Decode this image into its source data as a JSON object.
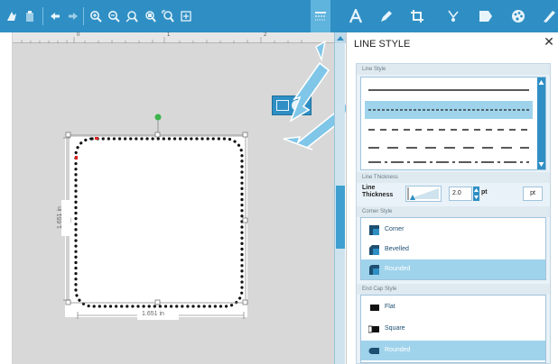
{
  "panel": {
    "title": "LINE STYLE",
    "close_glyph": "✕",
    "sections": {
      "line_style": "Line Style",
      "line_thickness": "Line Thickness",
      "corner_style": "Corner Style",
      "end_cap_style": "End Cap Style"
    },
    "line_styles": [
      "solid",
      "dash-fine",
      "dash-medium",
      "dash-long",
      "dash-dot"
    ],
    "selected_line_style": 1,
    "thickness": {
      "label_line1": "Line",
      "label_line2": "Thickness",
      "value": "2.0",
      "unit": "pt",
      "unit_button": "pt"
    },
    "corner_options": [
      {
        "label": "Corner",
        "icon": "corner-square-icon",
        "selected": false
      },
      {
        "label": "Bevelled",
        "icon": "corner-bevel-icon",
        "selected": false
      },
      {
        "label": "Rounded",
        "icon": "corner-round-icon",
        "selected": true
      }
    ],
    "end_cap_options": [
      {
        "label": "Flat",
        "icon": "cap-flat-icon",
        "selected": false
      },
      {
        "label": "Square",
        "icon": "cap-square-icon",
        "selected": false
      },
      {
        "label": "Rounded",
        "icon": "cap-round-icon",
        "selected": true
      }
    ]
  },
  "canvas": {
    "width_label": "1.651 in",
    "height_label": "1.651 in",
    "ruler_marks": [
      "0",
      "1",
      "2"
    ]
  },
  "colors": {
    "toolbar": "#2f8fc4",
    "accent": "#3fa0d0",
    "selection": "#9fd3ec",
    "handle_green": "#3db34a"
  },
  "toolbar_icons": [
    "pick-tool-icon",
    "paste-icon",
    "undo-icon",
    "redo-icon",
    "zoom-in-icon",
    "zoom-out-icon",
    "zoom-fit-icon",
    "zoom-selection-icon",
    "zoom-all-icon",
    "add-page-icon",
    "line-style-icon",
    "text-icon",
    "pen-icon",
    "crop-icon",
    "node-edit-icon",
    "shape-icon",
    "color-palette-icon",
    "eraser-icon"
  ]
}
